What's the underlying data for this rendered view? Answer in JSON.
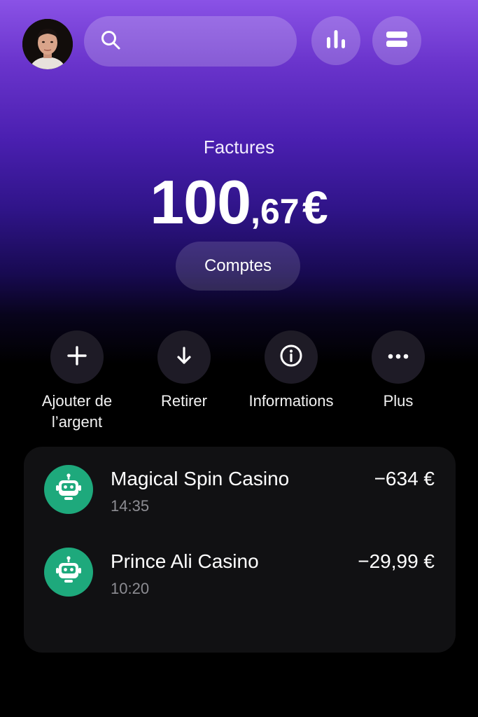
{
  "search": {
    "placeholder": ""
  },
  "icons": {
    "search": "search-icon",
    "stats": "bar-chart-icon",
    "cards": "cards-icon",
    "add": "plus-icon",
    "withdraw": "arrow-down-icon",
    "info": "info-icon",
    "more": "more-icon",
    "merchant": "robot-icon"
  },
  "balance": {
    "label": "Factures",
    "integer": "100",
    "decimal": ",67",
    "currency": "€"
  },
  "accounts_button": "Comptes",
  "actions": [
    {
      "line1": "Ajouter de",
      "line2": "l’argent"
    },
    {
      "line1": "Retirer",
      "line2": ""
    },
    {
      "line1": "Informations",
      "line2": ""
    },
    {
      "line1": "Plus",
      "line2": ""
    }
  ],
  "transactions": [
    {
      "name": "Magical Spin Casino",
      "time": "14:35",
      "amount": "−634 €"
    },
    {
      "name": "Prince Ali Casino",
      "time": "10:20",
      "amount": "−29,99 €"
    }
  ],
  "colors": {
    "gradient_top": "#8a52e6",
    "merchant_green": "#1ea97c",
    "card_bg": "#111113"
  }
}
